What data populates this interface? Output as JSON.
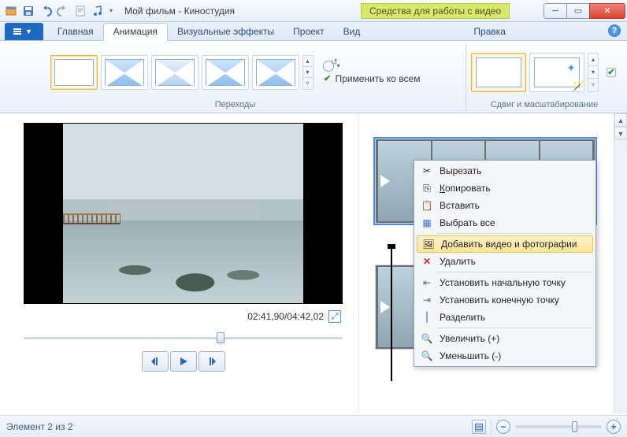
{
  "title": "Мой фильм - Киностудия",
  "context_tab": "Средства для работы с видео",
  "tabs": {
    "file": "",
    "home": "Главная",
    "animation": "Анимация",
    "visual": "Визуальные эффекты",
    "project": "Проект",
    "view": "Вид",
    "edit": "Правка"
  },
  "ribbon": {
    "transitions_label": "Переходы",
    "apply_all": "Применить ко всем",
    "pan_zoom_label": "Сдвиг и масштабирование"
  },
  "preview": {
    "time": "02:41,90/04:42,02"
  },
  "context_menu": {
    "cut": "Вырезать",
    "copy": "Копировать",
    "paste": "Вставить",
    "select_all": "Выбрать все",
    "add_media": "Добавить видео и фотографии",
    "delete": "Удалить",
    "set_start": "Установить начальную точку",
    "set_end": "Установить конечную точку",
    "split": "Разделить",
    "zoom_in": "Увеличить (+)",
    "zoom_out": "Уменьшить (-)"
  },
  "status": {
    "left": "Элемент 2 из 2"
  }
}
